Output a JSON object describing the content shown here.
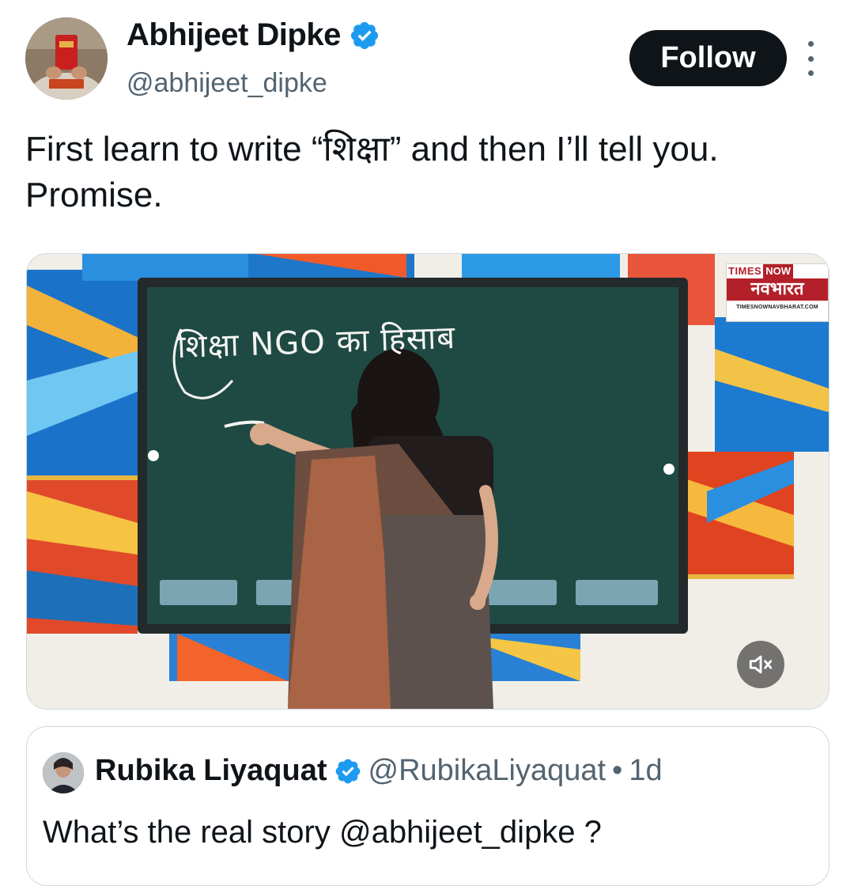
{
  "author": {
    "display_name": "Abhijeet Dipke",
    "handle": "@abhijeet_dipke",
    "verified": true,
    "avatar_icon": "avatar-photo"
  },
  "actions": {
    "follow_label": "Follow",
    "more_icon": "more-vertical-icon"
  },
  "tweet": {
    "text": "First learn to write “शिक्षा” and then I’ll tell you. Promise."
  },
  "media": {
    "board_text": "शिक्षा  NGO का हिसाब",
    "channel": {
      "times": "TIMES",
      "now": "NOW",
      "hindi": "नवभारत",
      "url": "TIMESNOWNAVBHARAT.COM"
    },
    "mute_icon": "volume-muted-icon"
  },
  "quoted": {
    "display_name": "Rubika Liyaquat",
    "handle": "@RubikaLiyaquat",
    "separator": "•",
    "time": "1d",
    "text": "What’s the real story @abhijeet_dipke ?"
  },
  "colors": {
    "verified_blue": "#1d9bf0",
    "text_primary": "#0f1419",
    "text_secondary": "#536471",
    "border": "#cfd9de"
  }
}
